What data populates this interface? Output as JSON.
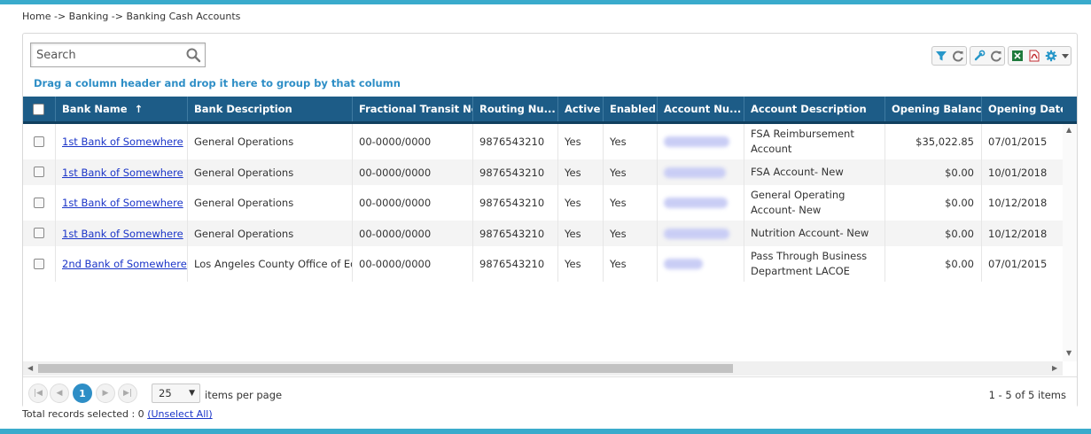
{
  "breadcrumb": {
    "text": "Home -> Banking -> Banking Cash Accounts"
  },
  "search": {
    "placeholder": "Search"
  },
  "toolbar": {
    "icons": [
      "filter-icon",
      "refresh-icon",
      "wrench-icon",
      "refresh-icon",
      "excel-icon",
      "pdf-icon",
      "gear-icon",
      "chevron-down-icon"
    ]
  },
  "grid": {
    "group_hint": "Drag a column header and drop it here to group by that column",
    "columns": {
      "bank_name": "Bank Name",
      "sort_arrow": "↑",
      "bank_description": "Bank Description",
      "fractional": "Fractional Transit No.",
      "routing": "Routing Nu...",
      "active": "Active",
      "enabled": "Enabled",
      "account_number": "Account Nu...",
      "account_description": "Account Description",
      "opening_balance": "Opening Balance",
      "opening_date": "Opening Date"
    },
    "rows": [
      {
        "bank_name": "1st Bank of Somewhere",
        "bank_description": "General Operations",
        "fractional": "00-0000/0000",
        "routing": "9876543210",
        "active": "Yes",
        "enabled": "Yes",
        "account_description": "FSA Reimbursement Account",
        "opening_balance": "$35,022.85",
        "opening_date": "07/01/2015"
      },
      {
        "bank_name": "1st Bank of Somewhere",
        "bank_description": "General Operations",
        "fractional": "00-0000/0000",
        "routing": "9876543210",
        "active": "Yes",
        "enabled": "Yes",
        "account_description": "FSA Account- New",
        "opening_balance": "$0.00",
        "opening_date": "10/01/2018"
      },
      {
        "bank_name": "1st Bank of Somewhere",
        "bank_description": "General Operations",
        "fractional": "00-0000/0000",
        "routing": "9876543210",
        "active": "Yes",
        "enabled": "Yes",
        "account_description": "General Operating Account- New",
        "opening_balance": "$0.00",
        "opening_date": "10/12/2018"
      },
      {
        "bank_name": "1st Bank of Somewhere",
        "bank_description": "General Operations",
        "fractional": "00-0000/0000",
        "routing": "9876543210",
        "active": "Yes",
        "enabled": "Yes",
        "account_description": "Nutrition Account- New",
        "opening_balance": "$0.00",
        "opening_date": "10/12/2018"
      },
      {
        "bank_name": "2nd Bank of Somewhere",
        "bank_description": "Los Angeles County Office of Ed",
        "fractional": "00-0000/0000",
        "routing": "9876543210",
        "active": "Yes",
        "enabled": "Yes",
        "account_description": "Pass Through Business Department LACOE",
        "opening_balance": "$0.00",
        "opening_date": "07/01/2015"
      }
    ]
  },
  "pager": {
    "current_page": "1",
    "page_size": "25",
    "per_page_label": "items per page",
    "info": "1 - 5 of 5 items"
  },
  "selection": {
    "label": "Total records selected : 0",
    "unselect": "(Unselect All)"
  },
  "colors": {
    "accent_bar": "#3aabcc",
    "header_bg": "#1d5c87",
    "link": "#1a34c8",
    "hint": "#2e8ec6"
  }
}
